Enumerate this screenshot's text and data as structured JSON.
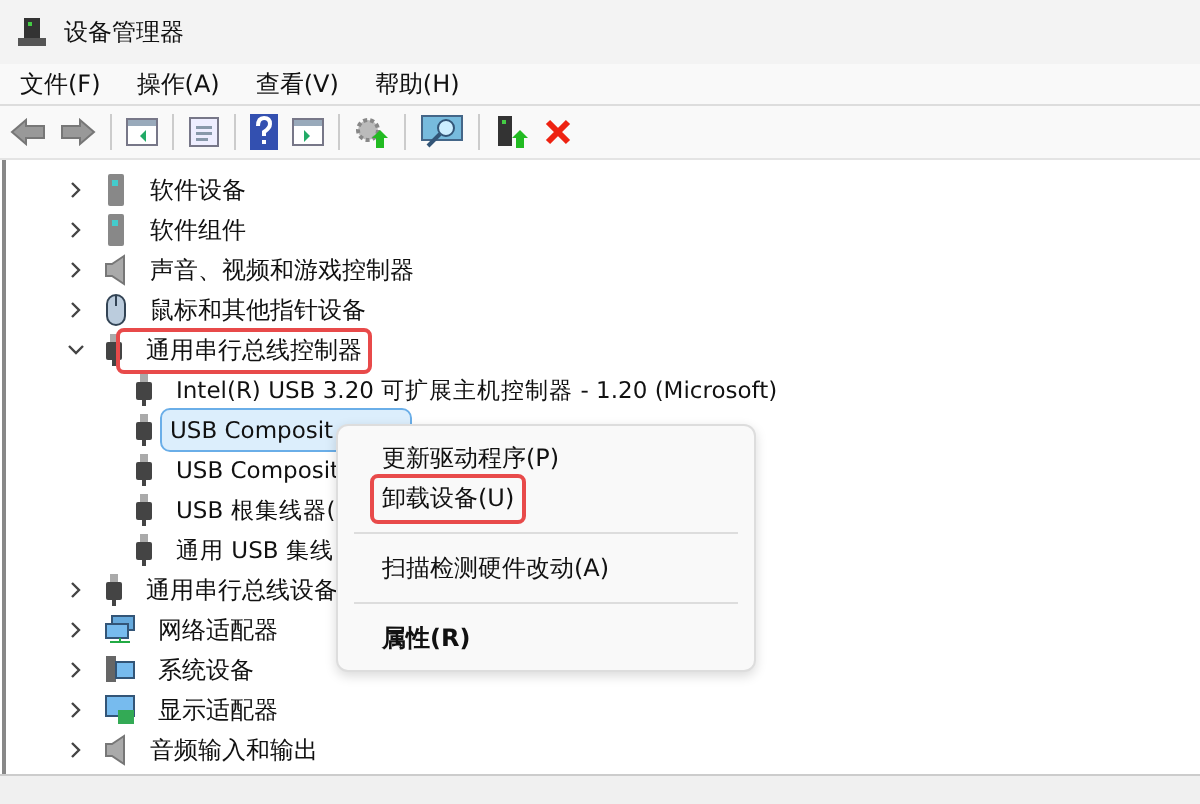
{
  "window": {
    "title": "设备管理器"
  },
  "menu_bar": [
    "文件(F)",
    "操作(A)",
    "查看(V)",
    "帮助(H)"
  ],
  "tree": {
    "items": [
      {
        "label": "软件设备",
        "expanded": false,
        "selected": false,
        "highlighted": false
      },
      {
        "label": "软件组件",
        "expanded": false,
        "selected": false,
        "highlighted": false
      },
      {
        "label": "声音、视频和游戏控制器",
        "expanded": false,
        "selected": false,
        "highlighted": false
      },
      {
        "label": "鼠标和其他指针设备",
        "expanded": false,
        "selected": false,
        "highlighted": false
      },
      {
        "label": "通用串行总线控制器",
        "expanded": true,
        "selected": false,
        "highlighted": true,
        "children": [
          {
            "label": "Intel(R) USB 3.20 可扩展主机控制器 - 1.20 (Microsoft)",
            "selected": false
          },
          {
            "label": "USB Composit",
            "selected": true
          },
          {
            "label": "USB Composit",
            "selected": false
          },
          {
            "label": "USB 根集线器(",
            "selected": false
          },
          {
            "label": "通用 USB 集线",
            "selected": false
          }
        ]
      },
      {
        "label": "通用串行总线设备",
        "expanded": false,
        "selected": false,
        "highlighted": false
      },
      {
        "label": "网络适配器",
        "expanded": false,
        "selected": false,
        "highlighted": false
      },
      {
        "label": "系统设备",
        "expanded": false,
        "selected": false,
        "highlighted": false
      },
      {
        "label": "显示适配器",
        "expanded": false,
        "selected": false,
        "highlighted": false
      },
      {
        "label": "音频输入和输出",
        "expanded": false,
        "selected": false,
        "highlighted": false
      }
    ]
  },
  "context_menu": [
    {
      "kind": "item",
      "label": "更新驱动程序(P)",
      "bold": false,
      "highlighted": false
    },
    {
      "kind": "item",
      "label": "卸载设备(U)",
      "bold": false,
      "highlighted": true
    },
    {
      "kind": "separator"
    },
    {
      "kind": "item",
      "label": "扫描检测硬件改动(A)",
      "bold": false,
      "highlighted": false
    },
    {
      "kind": "separator"
    },
    {
      "kind": "item",
      "label": "属性(R)",
      "bold": true,
      "highlighted": false
    }
  ]
}
